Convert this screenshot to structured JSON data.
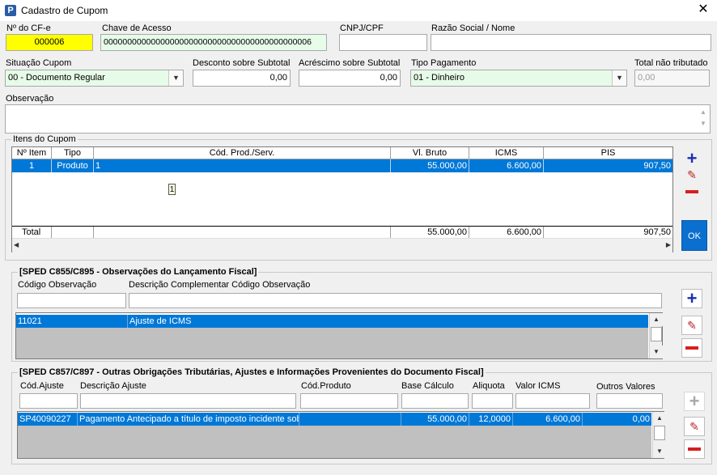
{
  "window": {
    "title": "Cadastro de Cupom",
    "app_icon_letter": "P"
  },
  "header": {
    "cfe_label": "Nº do CF-e",
    "cfe_value": "000006",
    "chave_label": "Chave de Acesso",
    "chave_value": "00000000000000000000000000000000000000000006",
    "cnpj_label": "CNPJ/CPF",
    "cnpj_value": "",
    "razao_label": "Razão Social / Nome",
    "razao_value": "",
    "situacao_label": "Situação Cupom",
    "situacao_value": "00 - Documento Regular",
    "desconto_label": "Desconto sobre Subtotal",
    "desconto_value": "0,00",
    "acrescimo_label": "Acréscimo sobre Subtotal",
    "acrescimo_value": "0,00",
    "tipo_pag_label": "Tipo Pagamento",
    "tipo_pag_value": "01 - Dinheiro",
    "total_nt_label": "Total não tributado",
    "total_nt_value": "0,00",
    "obs_label": "Observação",
    "obs_value": ""
  },
  "itens": {
    "title": "Itens do Cupom",
    "columns": [
      "Nº Item",
      "Tipo",
      "Cód. Prod./Serv.",
      "Vl. Bruto",
      "ICMS",
      "PIS"
    ],
    "row": [
      "1",
      "Produto",
      "1",
      "55.000,00",
      "6.600,00",
      "907,50"
    ],
    "tooltip": "1",
    "total_label": "Total",
    "total_vl_bruto": "55.000,00",
    "total_icms": "6.600,00",
    "total_pis": "907,50",
    "ok_label": "OK"
  },
  "c855": {
    "title": "[SPED C855/C895 - Observações do Lançamento Fiscal]",
    "codigo_label": "Código Observação",
    "desc_label": "Descrição Complementar Código Observação",
    "codigo_value": "",
    "desc_value": "",
    "row": [
      "11021",
      "Ajuste de ICMS"
    ]
  },
  "c857": {
    "title": "[SPED C857/C897 - Outras Obrigações Tributárias, Ajustes e Informações Provenientes do Documento Fiscal]",
    "labels": [
      "Cód.Ajuste",
      "Descrição Ajuste",
      "Cód.Produto",
      "Base Cálculo",
      "Aliquota",
      "Valor ICMS",
      "Outros Valores"
    ],
    "row": [
      "SP40090227",
      "Pagamento Antecipado a título de imposto incidente sobr",
      "",
      "55.000,00",
      "12,0000",
      "6.600,00",
      "0,00"
    ]
  },
  "colors": {
    "selection": "#0078d7",
    "cfe_bg": "#ffff00",
    "readonly_bg": "#e6fbe8",
    "add_icon": "#1a2fb5",
    "remove_icon": "#d81e1e"
  }
}
